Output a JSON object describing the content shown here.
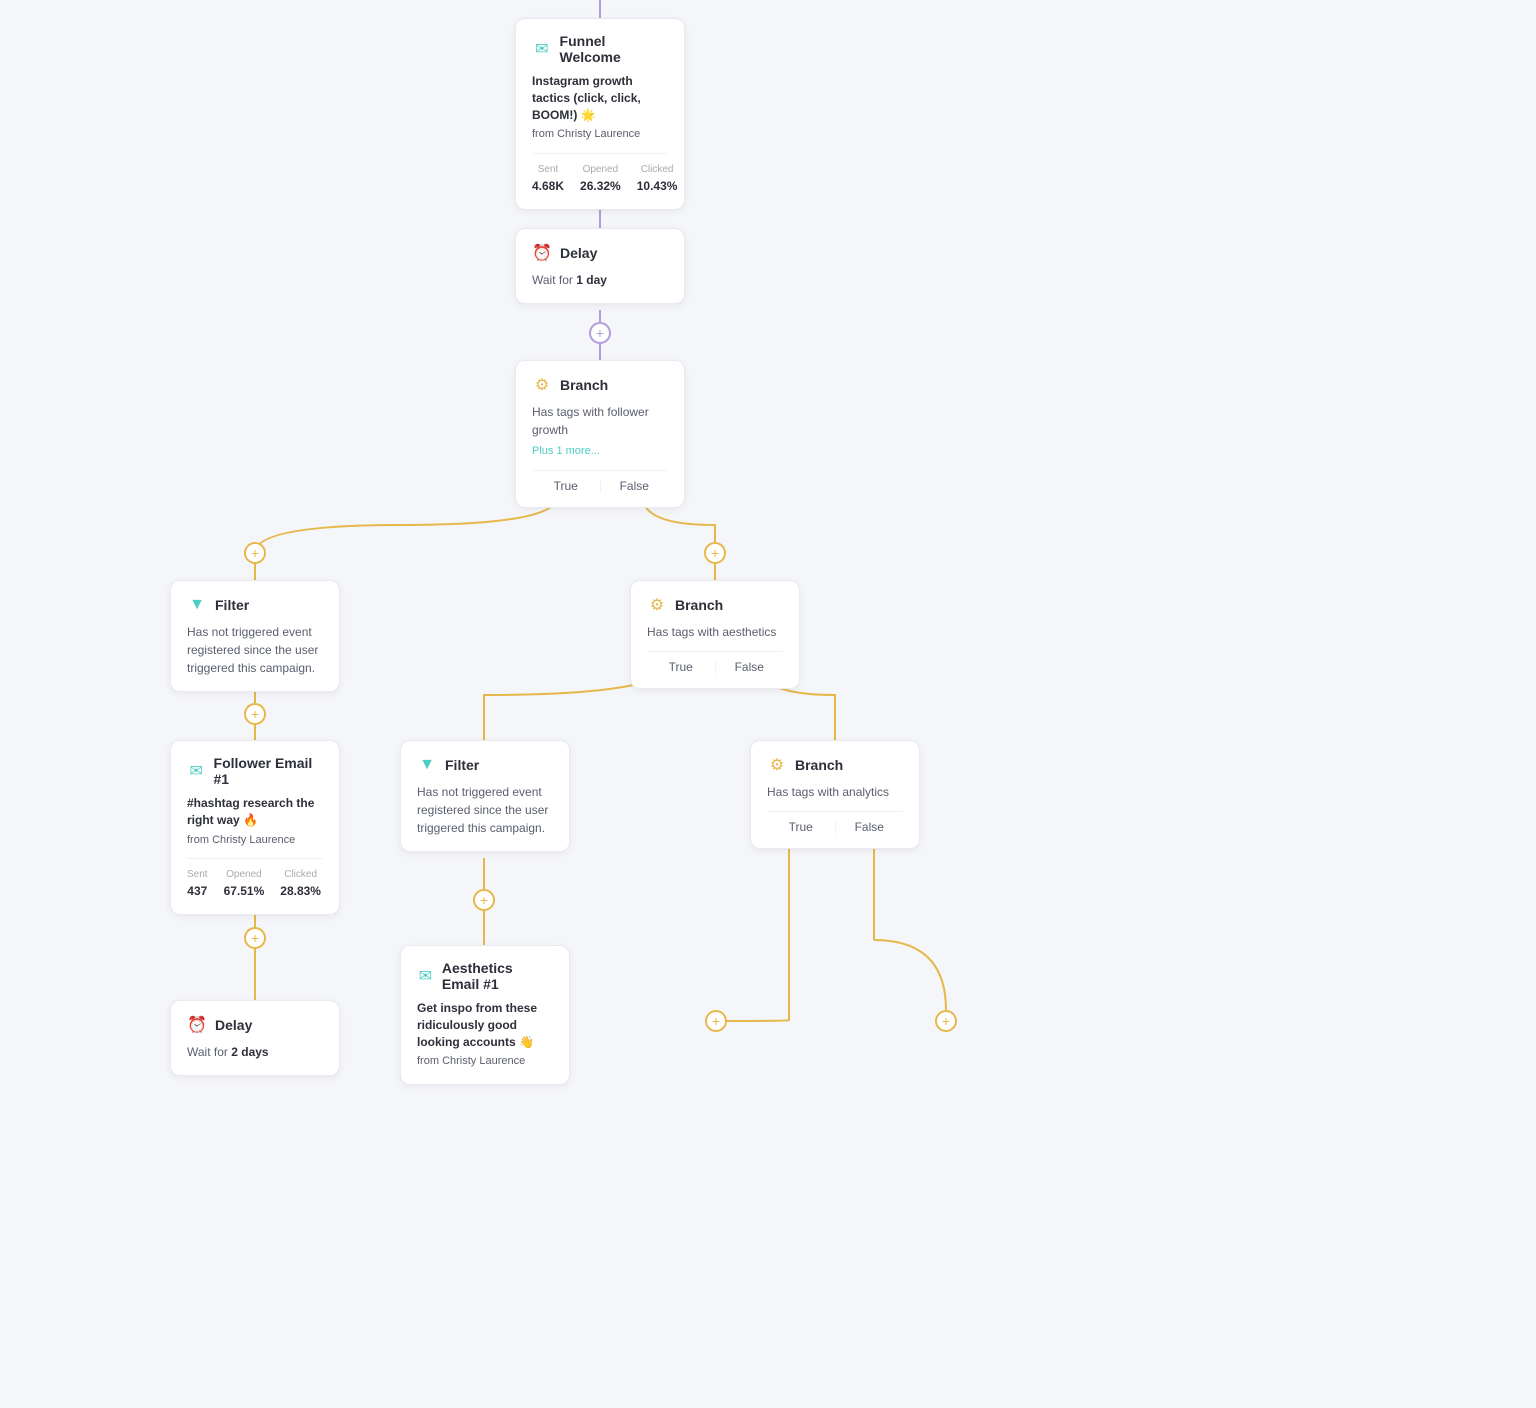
{
  "funnel_welcome": {
    "title": "Funnel Welcome",
    "email_title": "Instagram growth tactics (click, click, BOOM!) 🌟",
    "from_label": "from",
    "from_name": "Christy Laurence",
    "stats": {
      "sent_label": "Sent",
      "sent_value": "4.68K",
      "opened_label": "Opened",
      "opened_value": "26.32%",
      "clicked_label": "Clicked",
      "clicked_value": "10.43%"
    }
  },
  "delay1": {
    "title": "Delay",
    "text": "Wait for ",
    "bold": "1 day"
  },
  "branch1": {
    "title": "Branch",
    "description": "Has tags with follower growth",
    "more": "Plus 1 more...",
    "true_label": "True",
    "false_label": "False"
  },
  "filter1": {
    "title": "Filter",
    "description": "Has not triggered event registered since the user triggered this campaign."
  },
  "follower_email": {
    "title": "Follower Email #1",
    "email_title": "#hashtag research the right way 🔥",
    "from_label": "from",
    "from_name": "Christy Laurence",
    "stats": {
      "sent_label": "Sent",
      "sent_value": "437",
      "opened_label": "Opened",
      "opened_value": "67.51%",
      "clicked_label": "Clicked",
      "clicked_value": "28.83%"
    }
  },
  "delay2": {
    "title": "Delay",
    "text": "Wait for ",
    "bold": "2 days"
  },
  "branch2": {
    "title": "Branch",
    "description": "Has tags with aesthetics",
    "true_label": "True",
    "false_label": "False"
  },
  "filter2": {
    "title": "Filter",
    "description": "Has not triggered event registered since the user triggered this campaign."
  },
  "aesthetics_email": {
    "title": "Aesthetics Email #1",
    "email_title": "Get inspo from these ridiculously good looking accounts 👋",
    "from_label": "from",
    "from_name": "Christy Laurence"
  },
  "branch3": {
    "title": "Branch",
    "description": "Has tags with analytics",
    "true_label": "True",
    "false_label": "False"
  }
}
